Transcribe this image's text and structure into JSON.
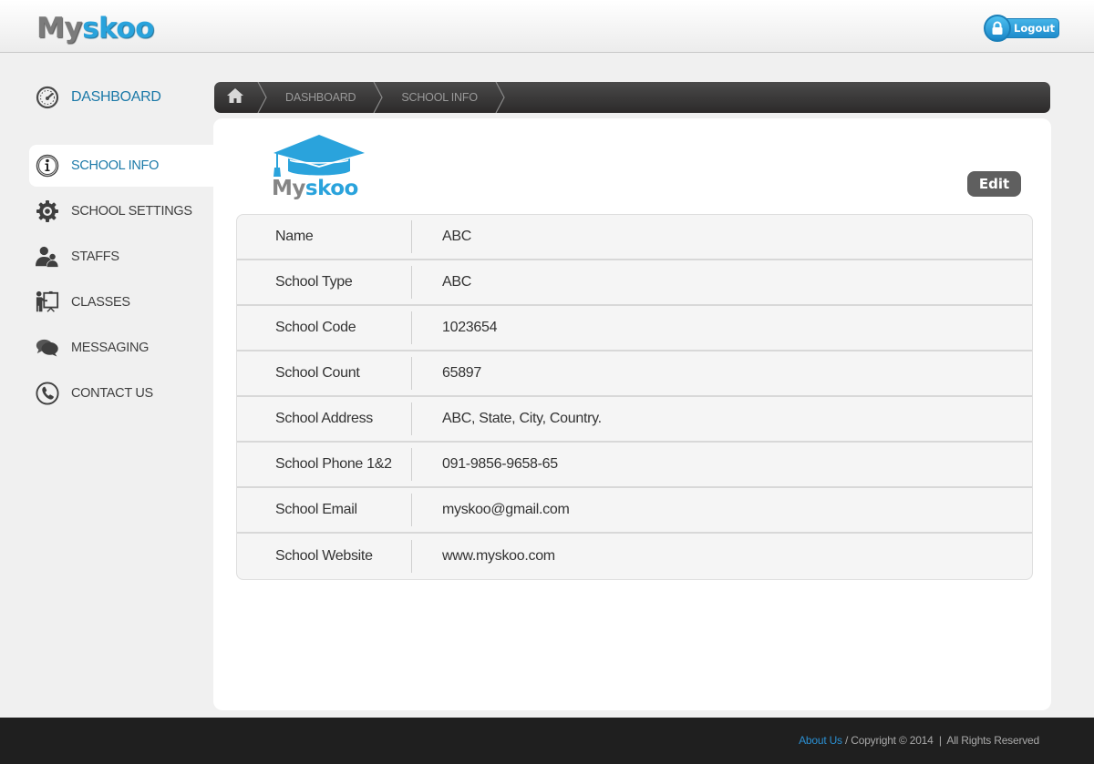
{
  "header": {
    "logo": {
      "part1": "My",
      "part2": "skoo"
    },
    "logout_label": "Logout"
  },
  "sidebar": {
    "items": [
      {
        "label": "DASHBOARD",
        "icon": "dashboard-gauge-icon"
      },
      {
        "label": "SCHOOL INFO",
        "icon": "info-icon",
        "active": true
      },
      {
        "label": "SCHOOL SETTINGS",
        "icon": "gear-icon"
      },
      {
        "label": "STAFFS",
        "icon": "users-icon"
      },
      {
        "label": "CLASSES",
        "icon": "teacher-board-icon"
      },
      {
        "label": "MESSAGING",
        "icon": "chat-bubbles-icon"
      },
      {
        "label": "CONTACT US",
        "icon": "phone-icon"
      }
    ]
  },
  "breadcrumb": {
    "home_icon": "home-icon",
    "items": [
      "DASHBOARD",
      "SCHOOL INFO"
    ]
  },
  "main": {
    "school_logo": {
      "part1": "My",
      "part2": "skoo",
      "icon": "graduation-cap-icon"
    },
    "edit_label": "Edit",
    "fields": [
      {
        "label": "Name",
        "value": "ABC"
      },
      {
        "label": "School Type",
        "value": "ABC"
      },
      {
        "label": "School Code",
        "value": "1023654"
      },
      {
        "label": "School Count",
        "value": "65897"
      },
      {
        "label": "School Address",
        "value": "ABC, State, City, Country."
      },
      {
        "label": "School Phone 1&2",
        "value": "091-9856-9658-65"
      },
      {
        "label": "School Email",
        "value": "myskoo@gmail.com"
      },
      {
        "label": "School Website",
        "value": "www.myskoo.com"
      }
    ]
  },
  "footer": {
    "about_label": "About Us",
    "copyright": " / Copyright © 2014  |  All Rights Reserved"
  },
  "colors": {
    "accent": "#29a3dc",
    "nav_active_text": "#1b79a8",
    "footer_bg": "#1f1f1f",
    "edit_button": "#5f5f5f"
  }
}
